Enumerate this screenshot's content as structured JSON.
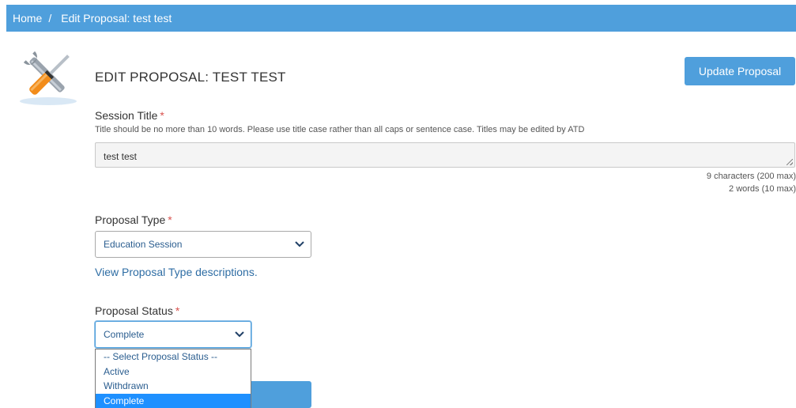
{
  "breadcrumb": {
    "home": "Home",
    "separator": "/",
    "current": "Edit Proposal: test test"
  },
  "page": {
    "title": "EDIT PROPOSAL: TEST TEST",
    "update_button": "Update Proposal"
  },
  "session_title": {
    "label": "Session Title",
    "required_mark": "*",
    "help": "Title should be no more than 10 words. Please use title case rather than all caps or sentence case. Titles may be edited by ATD",
    "value": "test test",
    "char_count": "9 characters (200 max)",
    "word_count": "2 words (10 max)"
  },
  "proposal_type": {
    "label": "Proposal Type",
    "required_mark": "*",
    "selected": "Education Session",
    "link": "View Proposal Type descriptions."
  },
  "proposal_status": {
    "label": "Proposal Status",
    "required_mark": "*",
    "selected": "Complete",
    "options": [
      "-- Select Proposal Status --",
      "Active",
      "Withdrawn",
      "Complete"
    ]
  },
  "colors": {
    "accent": "#4f9fdc",
    "link": "#2e6da4",
    "required": "#d9534f",
    "option_highlight": "#1e90ff"
  },
  "icons": [
    "tools-icon",
    "chevron-down-icon"
  ]
}
